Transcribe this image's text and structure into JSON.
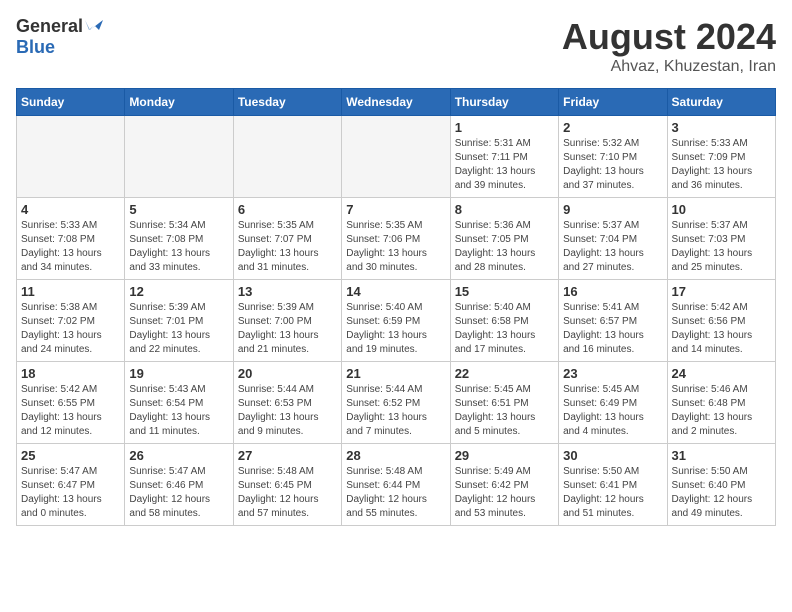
{
  "header": {
    "logo_general": "General",
    "logo_blue": "Blue",
    "title": "August 2024",
    "location": "Ahvaz, Khuzestan, Iran"
  },
  "weekdays": [
    "Sunday",
    "Monday",
    "Tuesday",
    "Wednesday",
    "Thursday",
    "Friday",
    "Saturday"
  ],
  "weeks": [
    [
      {
        "day": "",
        "empty": true
      },
      {
        "day": "",
        "empty": true
      },
      {
        "day": "",
        "empty": true
      },
      {
        "day": "",
        "empty": true
      },
      {
        "day": "1",
        "sunrise": "5:31 AM",
        "sunset": "7:11 PM",
        "daylight": "13 hours and 39 minutes."
      },
      {
        "day": "2",
        "sunrise": "5:32 AM",
        "sunset": "7:10 PM",
        "daylight": "13 hours and 37 minutes."
      },
      {
        "day": "3",
        "sunrise": "5:33 AM",
        "sunset": "7:09 PM",
        "daylight": "13 hours and 36 minutes."
      }
    ],
    [
      {
        "day": "4",
        "sunrise": "5:33 AM",
        "sunset": "7:08 PM",
        "daylight": "13 hours and 34 minutes."
      },
      {
        "day": "5",
        "sunrise": "5:34 AM",
        "sunset": "7:08 PM",
        "daylight": "13 hours and 33 minutes."
      },
      {
        "day": "6",
        "sunrise": "5:35 AM",
        "sunset": "7:07 PM",
        "daylight": "13 hours and 31 minutes."
      },
      {
        "day": "7",
        "sunrise": "5:35 AM",
        "sunset": "7:06 PM",
        "daylight": "13 hours and 30 minutes."
      },
      {
        "day": "8",
        "sunrise": "5:36 AM",
        "sunset": "7:05 PM",
        "daylight": "13 hours and 28 minutes."
      },
      {
        "day": "9",
        "sunrise": "5:37 AM",
        "sunset": "7:04 PM",
        "daylight": "13 hours and 27 minutes."
      },
      {
        "day": "10",
        "sunrise": "5:37 AM",
        "sunset": "7:03 PM",
        "daylight": "13 hours and 25 minutes."
      }
    ],
    [
      {
        "day": "11",
        "sunrise": "5:38 AM",
        "sunset": "7:02 PM",
        "daylight": "13 hours and 24 minutes."
      },
      {
        "day": "12",
        "sunrise": "5:39 AM",
        "sunset": "7:01 PM",
        "daylight": "13 hours and 22 minutes."
      },
      {
        "day": "13",
        "sunrise": "5:39 AM",
        "sunset": "7:00 PM",
        "daylight": "13 hours and 21 minutes."
      },
      {
        "day": "14",
        "sunrise": "5:40 AM",
        "sunset": "6:59 PM",
        "daylight": "13 hours and 19 minutes."
      },
      {
        "day": "15",
        "sunrise": "5:40 AM",
        "sunset": "6:58 PM",
        "daylight": "13 hours and 17 minutes."
      },
      {
        "day": "16",
        "sunrise": "5:41 AM",
        "sunset": "6:57 PM",
        "daylight": "13 hours and 16 minutes."
      },
      {
        "day": "17",
        "sunrise": "5:42 AM",
        "sunset": "6:56 PM",
        "daylight": "13 hours and 14 minutes."
      }
    ],
    [
      {
        "day": "18",
        "sunrise": "5:42 AM",
        "sunset": "6:55 PM",
        "daylight": "13 hours and 12 minutes."
      },
      {
        "day": "19",
        "sunrise": "5:43 AM",
        "sunset": "6:54 PM",
        "daylight": "13 hours and 11 minutes."
      },
      {
        "day": "20",
        "sunrise": "5:44 AM",
        "sunset": "6:53 PM",
        "daylight": "13 hours and 9 minutes."
      },
      {
        "day": "21",
        "sunrise": "5:44 AM",
        "sunset": "6:52 PM",
        "daylight": "13 hours and 7 minutes."
      },
      {
        "day": "22",
        "sunrise": "5:45 AM",
        "sunset": "6:51 PM",
        "daylight": "13 hours and 5 minutes."
      },
      {
        "day": "23",
        "sunrise": "5:45 AM",
        "sunset": "6:49 PM",
        "daylight": "13 hours and 4 minutes."
      },
      {
        "day": "24",
        "sunrise": "5:46 AM",
        "sunset": "6:48 PM",
        "daylight": "13 hours and 2 minutes."
      }
    ],
    [
      {
        "day": "25",
        "sunrise": "5:47 AM",
        "sunset": "6:47 PM",
        "daylight": "13 hours and 0 minutes."
      },
      {
        "day": "26",
        "sunrise": "5:47 AM",
        "sunset": "6:46 PM",
        "daylight": "12 hours and 58 minutes."
      },
      {
        "day": "27",
        "sunrise": "5:48 AM",
        "sunset": "6:45 PM",
        "daylight": "12 hours and 57 minutes."
      },
      {
        "day": "28",
        "sunrise": "5:48 AM",
        "sunset": "6:44 PM",
        "daylight": "12 hours and 55 minutes."
      },
      {
        "day": "29",
        "sunrise": "5:49 AM",
        "sunset": "6:42 PM",
        "daylight": "12 hours and 53 minutes."
      },
      {
        "day": "30",
        "sunrise": "5:50 AM",
        "sunset": "6:41 PM",
        "daylight": "12 hours and 51 minutes."
      },
      {
        "day": "31",
        "sunrise": "5:50 AM",
        "sunset": "6:40 PM",
        "daylight": "12 hours and 49 minutes."
      }
    ]
  ],
  "labels": {
    "sunrise": "Sunrise:",
    "sunset": "Sunset:",
    "daylight": "Daylight:"
  }
}
